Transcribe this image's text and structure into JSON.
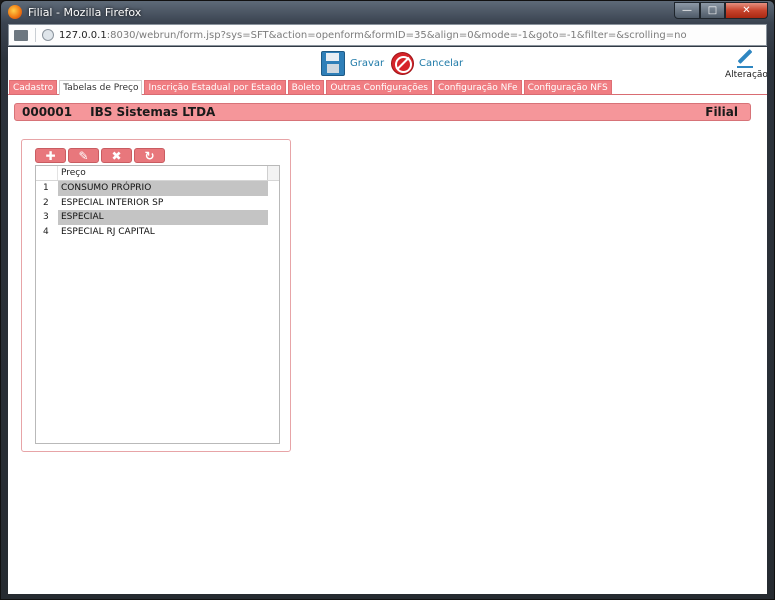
{
  "window": {
    "title": "Filial - Mozilla Firefox",
    "url_host": "127.0.0.1",
    "url_rest": ":8030/webrun/form.jsp?sys=SFT&action=openform&formID=35&align=0&mode=-1&goto=-1&filter=&scrolling=no"
  },
  "toolbar": {
    "save_label": "Gravar",
    "cancel_label": "Cancelar",
    "mode_label": "Alteração"
  },
  "tabs": [
    {
      "label": "Cadastro"
    },
    {
      "label": "Tabelas de Preço"
    },
    {
      "label": "Inscrição Estadual por Estado"
    },
    {
      "label": "Boleto"
    },
    {
      "label": "Outras Configurações"
    },
    {
      "label": "Configuração NFe"
    },
    {
      "label": "Configuração NFS"
    }
  ],
  "header": {
    "code": "000001",
    "name": "IBS Sistemas LTDA",
    "form": "Filial"
  },
  "grid": {
    "column": "Preço",
    "rows": [
      {
        "num": "1",
        "value": "CONSUMO PRÓPRIO"
      },
      {
        "num": "2",
        "value": "ESPECIAL INTERIOR SP"
      },
      {
        "num": "3",
        "value": "ESPECIAL"
      },
      {
        "num": "4",
        "value": "ESPECIAL RJ CAPITAL"
      }
    ]
  },
  "colors": {
    "accent": "#f07d82",
    "header_bg": "#f5969a",
    "link": "#1f7aa8"
  }
}
